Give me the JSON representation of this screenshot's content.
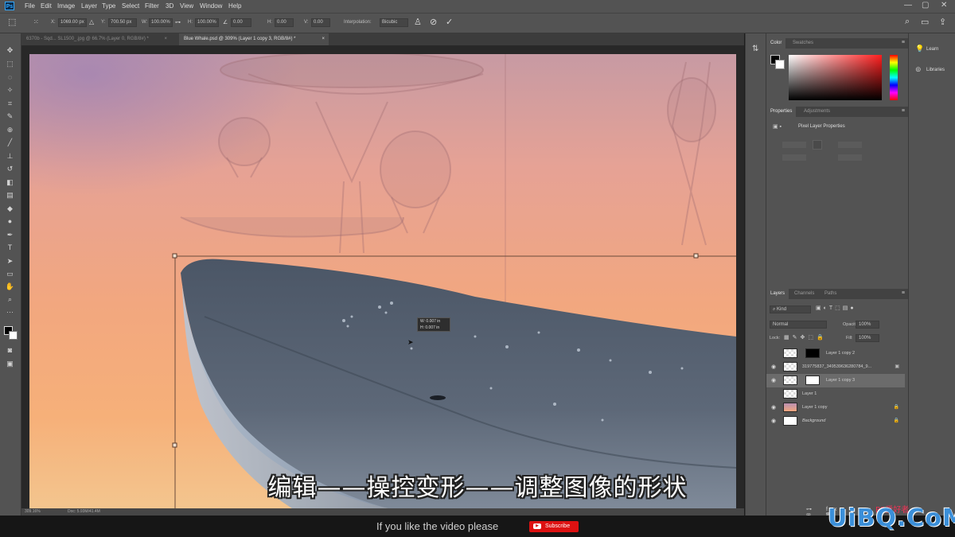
{
  "app": {
    "logo_text": "Ps"
  },
  "menu": [
    "File",
    "Edit",
    "Image",
    "Layer",
    "Type",
    "Select",
    "Filter",
    "3D",
    "View",
    "Window",
    "Help"
  ],
  "window_controls": {
    "minimize": "—",
    "maximize": "▢",
    "close": "✕"
  },
  "options_bar": {
    "x_label": "X:",
    "x_value": "1069.00 px",
    "y_label": "Y:",
    "y_value": "700.50 px",
    "w_label": "W:",
    "w_value": "100.00%",
    "h_label": "H:",
    "h_value": "100.00%",
    "angle_value": "0.00",
    "hskew_label": "H:",
    "hskew_value": "0.00",
    "vskew_label": "V:",
    "vskew_value": "0.00",
    "interp_label": "Interpolation:",
    "interp_value": "Bicubic"
  },
  "doc_tabs": [
    {
      "label": "6370b - Sqd... SL1500_.jpg @ 66.7% (Layer 0, RGB/8#) *",
      "active": false
    },
    {
      "label": "Blue Whale.psd @ 309% (Layer 1 copy 3, RGB/8#) *",
      "active": true
    }
  ],
  "canvas": {
    "transform_readout_1": "W: 0.007 in",
    "transform_readout_2": "H: 0.007 in"
  },
  "status": {
    "zoom": "309.16%",
    "doc": "Doc: 5.93M/41.4M"
  },
  "color_panel": {
    "tabs": [
      "Color",
      "Swatches"
    ]
  },
  "properties_panel": {
    "tabs": [
      "Properties",
      "Adjustments"
    ],
    "title": "Pixel Layer Properties"
  },
  "learn_panel": {
    "items": [
      "Learn",
      "Libraries"
    ]
  },
  "layers_panel": {
    "tabs": [
      "Layers",
      "Channels",
      "Paths"
    ],
    "kind_label": "Kind",
    "blend_mode": "Normal",
    "opacity_label": "Opacity:",
    "opacity_value": "100%",
    "lock_label": "Lock:",
    "fill_label": "Fill:",
    "fill_value": "100%",
    "layers": [
      {
        "name": "Layer 1 copy 2",
        "visible": false,
        "selected": false,
        "mask": "black"
      },
      {
        "name": "319775837_349539636280784_9...",
        "visible": true,
        "selected": false,
        "mask": "none"
      },
      {
        "name": "Layer 1 copy 3",
        "visible": true,
        "selected": true,
        "mask": "white"
      },
      {
        "name": "Layer 1",
        "visible": false,
        "selected": false,
        "mask": "none"
      },
      {
        "name": "Layer 1 copy",
        "visible": true,
        "selected": false,
        "mask": "none"
      },
      {
        "name": "Background",
        "visible": true,
        "selected": false,
        "mask": "none"
      }
    ]
  },
  "subtitle": "编辑——操控变形——调整图像的形状",
  "bottom": {
    "cta": "If you like the video please",
    "subscribe": "Subscribe"
  },
  "watermark": {
    "main": "UiBQ.CoM",
    "top": "PS爱好者"
  },
  "colors": {
    "accent": "#31a8ff",
    "subscribe_red": "#dd1111",
    "watermark_blue": "#3b8fd9"
  }
}
